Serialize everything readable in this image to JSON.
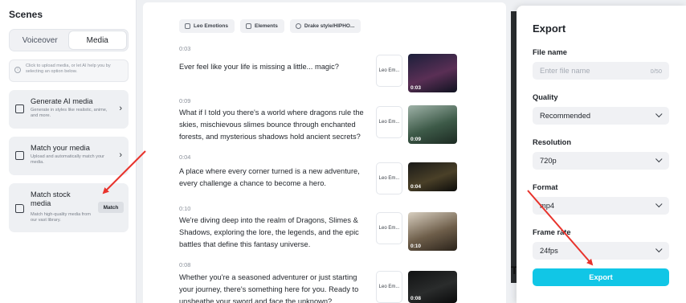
{
  "left": {
    "title": "Scenes",
    "tabs": [
      {
        "label": "Voiceover",
        "active": false
      },
      {
        "label": "Media",
        "active": true
      }
    ],
    "hint": "Click to upload media, or let AI help you by selecting an option below.",
    "cards": [
      {
        "title": "Generate AI media",
        "desc": "Generate in styles like realistic, anime, and more.",
        "icon": "image-sparkle-icon"
      },
      {
        "title": "Match your media",
        "desc": "Upload and automatically match your media.",
        "icon": "upload-image-icon"
      },
      {
        "title": "Match stock media",
        "desc": "Match high-quality media from our vast library.",
        "icon": "folder-icon",
        "button": "Match"
      }
    ]
  },
  "middle": {
    "chips": [
      {
        "label": "Leo Emotions",
        "icon": "voice-icon"
      },
      {
        "label": "Elements",
        "icon": "elements-icon"
      },
      {
        "label": "Drake style/HIPHO...",
        "icon": "music-icon"
      }
    ],
    "scenes": [
      {
        "time": "0:03",
        "text": "Ever feel like your life is missing a little... magic?",
        "voice": "Leo Em...",
        "duration": "0:03",
        "colors": [
          "#1b1f3a",
          "#5a2f55",
          "#0f1220"
        ]
      },
      {
        "time": "0:09",
        "text": "What if I told you there's a world where dragons rule the skies, mischievous slimes bounce through enchanted forests, and mysterious shadows hold ancient secrets?",
        "voice": "Leo Em...",
        "duration": "0:09",
        "colors": [
          "#9fb2a8",
          "#3d5a48",
          "#1c2a22"
        ]
      },
      {
        "time": "0:04",
        "text": "A place where every corner turned is a new adventure, every challenge a chance to become a hero.",
        "voice": "Leo Em...",
        "duration": "0:04",
        "colors": [
          "#1a1a18",
          "#4a4028",
          "#0c0c0a"
        ]
      },
      {
        "time": "0:10",
        "text": "We're diving deep into the realm of Dragons, Slimes & Shadows, exploring the lore, the legends, and the epic battles that define this fantasy universe.",
        "voice": "Leo Em...",
        "duration": "0:10",
        "colors": [
          "#d8cfc0",
          "#6e5e4a",
          "#2a221a"
        ]
      },
      {
        "time": "0:08",
        "text": "Whether you're a seasoned adventurer or just starting your journey, there's something here for you. Ready to unsheathe your sword and face the unknown?",
        "voice": "Leo Em...",
        "duration": "0:08",
        "colors": [
          "#111213",
          "#2a2c2c",
          "#0a0a0b"
        ]
      }
    ]
  },
  "export": {
    "title": "Export",
    "file_name_label": "File name",
    "file_name_placeholder": "Enter file name",
    "file_name_counter": "0/50",
    "quality_label": "Quality",
    "quality_value": "Recommended",
    "resolution_label": "Resolution",
    "resolution_value": "720p",
    "format_label": "Format",
    "format_value": "mp4",
    "framerate_label": "Frame rate",
    "framerate_value": "24fps",
    "button": "Export",
    "accent": "#11c6e6"
  },
  "annotation_color": "#e8332c"
}
